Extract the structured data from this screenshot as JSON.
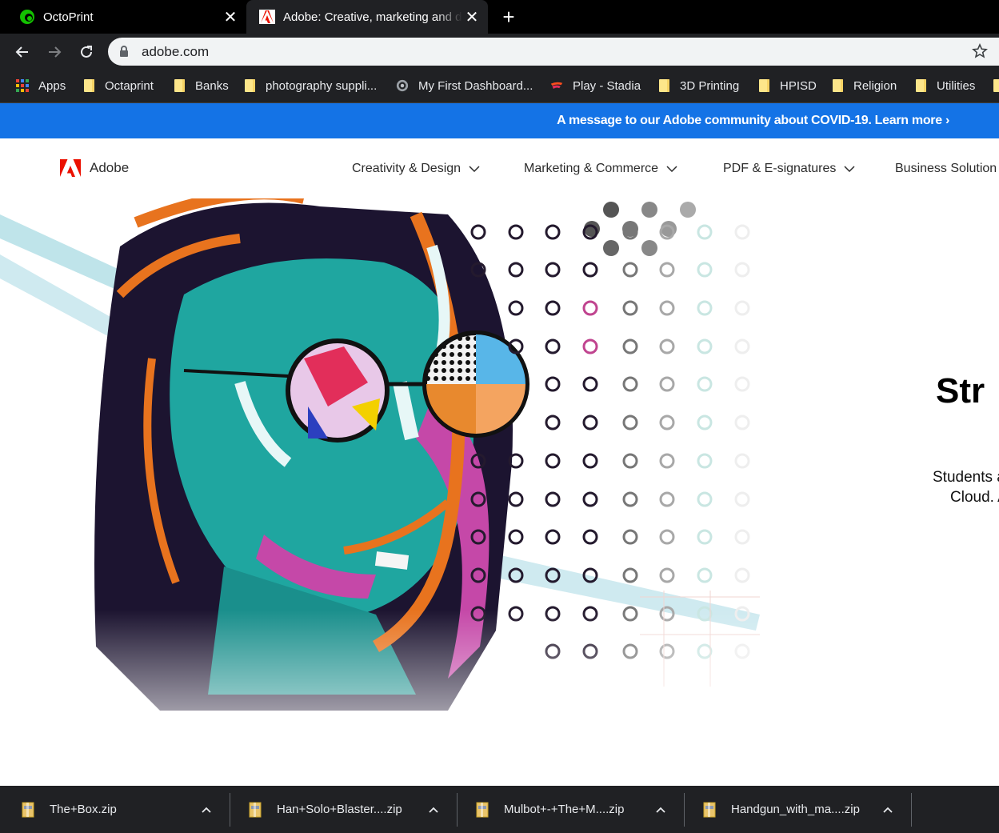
{
  "tabs": [
    {
      "title": "OctoPrint",
      "icon": "octoprint-icon"
    },
    {
      "title": "Adobe: Creative, marketing and document management solutions",
      "icon": "adobe-icon",
      "active": true
    }
  ],
  "toolbar": {
    "url": "adobe.com"
  },
  "bookmarks": [
    {
      "label": "Apps",
      "icon": "apps-grid-icon"
    },
    {
      "label": "Octaprint",
      "icon": "folder-icon"
    },
    {
      "label": "Banks",
      "icon": "folder-icon"
    },
    {
      "label": "photography suppli...",
      "icon": "folder-icon"
    },
    {
      "label": "My First Dashboard...",
      "icon": "dashboard-icon"
    },
    {
      "label": "Play - Stadia",
      "icon": "stadia-icon"
    },
    {
      "label": "3D Printing",
      "icon": "folder-icon"
    },
    {
      "label": "HPISD",
      "icon": "folder-icon"
    },
    {
      "label": "Religion",
      "icon": "folder-icon"
    },
    {
      "label": "Utilities",
      "icon": "folder-icon"
    }
  ],
  "banner": {
    "message": "A message to our Adobe community about COVID-19. Learn more ›",
    "color": "#1473e6"
  },
  "adobe_nav": {
    "brand": "Adobe",
    "items": [
      {
        "label": "Creativity & Design"
      },
      {
        "label": "Marketing & Commerce"
      },
      {
        "label": "PDF & E-signatures"
      },
      {
        "label": "Business Solution"
      }
    ]
  },
  "hero": {
    "title": "Str",
    "sub_line1": "Students a",
    "sub_line2": "Cloud. A"
  },
  "downloads": [
    {
      "name": "The+Box.zip"
    },
    {
      "name": "Han+Solo+Blaster....zip"
    },
    {
      "name": "Mulbot+-+The+M....zip"
    },
    {
      "name": "Handgun_with_ma....zip"
    }
  ]
}
